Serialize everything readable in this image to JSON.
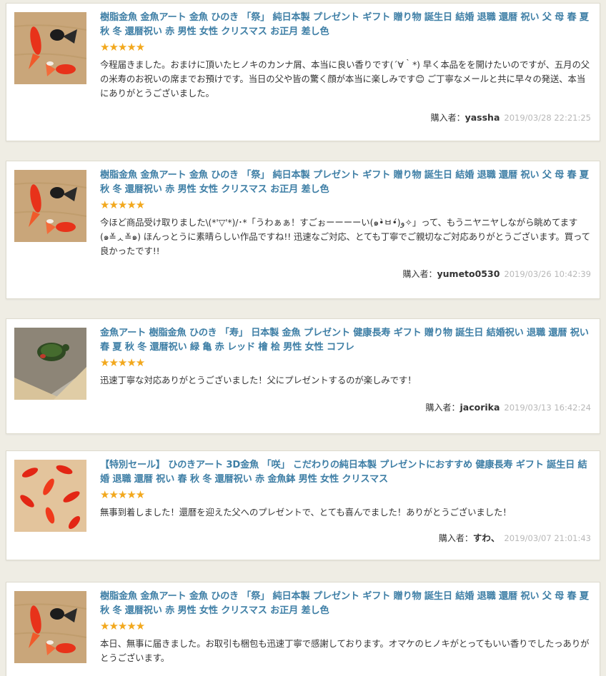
{
  "colors": {
    "background": "#efede4",
    "card": "#ffffff",
    "title_link": "#3f7fa6",
    "star": "#f2a81d",
    "date": "#b8b8b8"
  },
  "buyer_label": "購入者：",
  "reviews": [
    {
      "product_title": "樹脂金魚 金魚アート 金魚 ひのき 「祭」 純日本製 プレゼント ギフト 贈り物 誕生日 結婚 退職 還暦 祝い 父 母 春 夏 秋 冬 還暦祝い 赤 男性 女性 クリスマス お正月 差し色",
      "rating": 5,
      "stars": "★★★★★",
      "image_icon": "goldfish-icon",
      "body": "今程届きました。おまけに頂いたヒノキのカンナ屑、本当に良い香りです(´∀｀*) 早く本品をを開けたいのですが、五月の父の米寿のお祝いの席までお預けです。当日の父や皆の驚く顔が本当に楽しみです😊 ご丁寧なメールと共に早々の発送、本当にありがとうございました。",
      "buyer": "yassha",
      "date": "2019/03/28 22:21:25"
    },
    {
      "product_title": "樹脂金魚 金魚アート 金魚 ひのき 「祭」 純日本製 プレゼント ギフト 贈り物 誕生日 結婚 退職 還暦 祝い 父 母 春 夏 秋 冬 還暦祝い 赤 男性 女性 クリスマス お正月 差し色",
      "rating": 5,
      "stars": "★★★★★",
      "image_icon": "goldfish-icon",
      "body": "今ほど商品受け取りました\\(*'▽'*)/･*「うわぁぁ！すごぉーーーーい(๑•̀ㅂ•́)و✧」って、もうニヤニヤしながら眺めてます(๑≚ᆺ≚๑) ほんっとうに素晴らしい作品ですね!! 迅速なご対応、とても丁寧でご親切なご対応ありがとうございます。買って良かったです!!",
      "buyer": "yumeto0530",
      "date": "2019/03/26 10:42:39"
    },
    {
      "product_title": "金魚アート 樹脂金魚 ひのき 「寿」 日本製 金魚 プレゼント 健康長寿 ギフト 贈り物 誕生日 結婚祝い 退職 還暦 祝い 春 夏 秋 冬 還暦祝い 緑 亀 赤 レッド 檜 桧 男性 女性 コフレ",
      "rating": 5,
      "stars": "★★★★★",
      "image_icon": "turtle-icon",
      "body": "迅速丁寧な対応ありがとうございました！父にプレゼントするのが楽しみです！",
      "buyer": "jacorika",
      "date": "2019/03/13 16:42:24"
    },
    {
      "product_title": "【特別セール】 ひのきアート 3D金魚 「咲」 こだわりの純日本製 プレゼントにおすすめ 健康長寿 ギフト 誕生日 結婚 退職 還暦 祝い 春 秋 冬 還暦祝い 赤 金魚鉢 男性 女性 クリスマス",
      "rating": 5,
      "stars": "★★★★★",
      "image_icon": "goldfish-school-icon",
      "body": "無事到着しました！還暦を迎えた父へのプレゼントで、とても喜んでました！ありがとうございました！",
      "buyer": "すわ、",
      "date": "2019/03/07 21:01:43"
    },
    {
      "product_title": "樹脂金魚 金魚アート 金魚 ひのき 「祭」 純日本製 プレゼント ギフト 贈り物 誕生日 結婚 退職 還暦 祝い 父 母 春 夏 秋 冬 還暦祝い 赤 男性 女性 クリスマス お正月 差し色",
      "rating": 5,
      "stars": "★★★★★",
      "image_icon": "goldfish-icon",
      "body": "本日、無事に届きました。お取引も梱包も迅速丁寧で感謝しております。オマケのヒノキがとってもいい香りでしたっありがとうございます。",
      "buyer": "",
      "date": ""
    }
  ]
}
